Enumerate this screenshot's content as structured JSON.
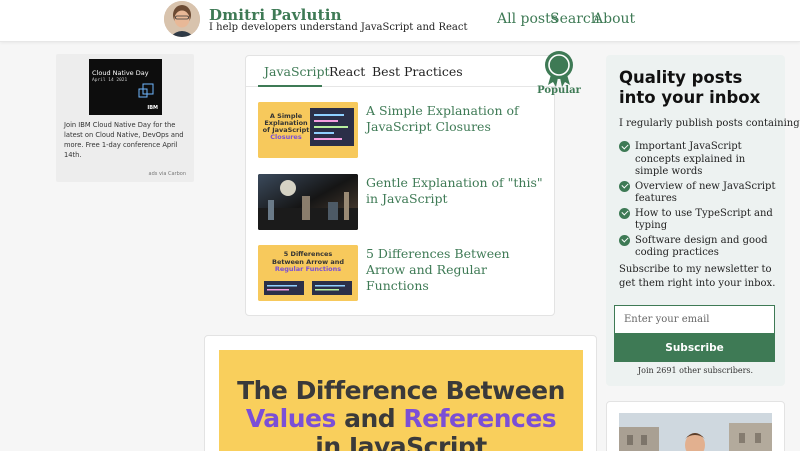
{
  "header": {
    "title": "Dmitri Pavlutin",
    "tagline": "I help developers understand JavaScript and React",
    "nav": [
      "All posts",
      "Search",
      "About"
    ]
  },
  "ad": {
    "image_title": "Cloud Native Day",
    "image_date": "April 14 2021",
    "image_brand": "IBM",
    "text": "Join IBM Cloud Native Day for the latest on Cloud Native, DevOps and more. Free 1-day conference April 14th.",
    "via": "ads via Carbon"
  },
  "popular": {
    "tabs": [
      "JavaScript",
      "React",
      "Best Practices"
    ],
    "active_tab": "JavaScript",
    "badge": "Popular",
    "posts": [
      {
        "title": "A Simple Explanation of JavaScript Closures",
        "thumb_lines": [
          "A Simple",
          "Explanation",
          "of JavaScript",
          "Closures"
        ]
      },
      {
        "title": "Gentle Explanation of \"this\" in JavaScript"
      },
      {
        "title": "5 Differences Between Arrow and Regular Functions",
        "thumb_lines": [
          "5 Differences",
          "Between Arrow and",
          "Regular Functions"
        ]
      }
    ]
  },
  "article": {
    "hero_lines": [
      {
        "parts": [
          {
            "text": "The Difference Between",
            "tone": "dark"
          }
        ]
      },
      {
        "parts": [
          {
            "text": "Values",
            "tone": "purple"
          },
          {
            "text": " and ",
            "tone": "dark"
          },
          {
            "text": "References",
            "tone": "purple"
          }
        ]
      },
      {
        "parts": [
          {
            "text": "in JavaScript",
            "tone": "dark"
          }
        ]
      }
    ]
  },
  "newsletter": {
    "title": "Quality posts into your inbox",
    "intro": "I regularly publish posts containing:",
    "items": [
      "Important JavaScript concepts explained in simple words",
      "Overview of new JavaScript features",
      "How to use TypeScript and typing",
      "Software design and good coding practices"
    ],
    "subscribe_text": "Subscribe to my newsletter to get them right into your inbox.",
    "email_placeholder": "Enter your email",
    "button": "Subscribe",
    "count_text": "Join 2691 other subscribers."
  },
  "colors": {
    "brand_green": "#3e7a55",
    "purple": "#7b4fd6",
    "yellow": "#f9cf5c"
  }
}
